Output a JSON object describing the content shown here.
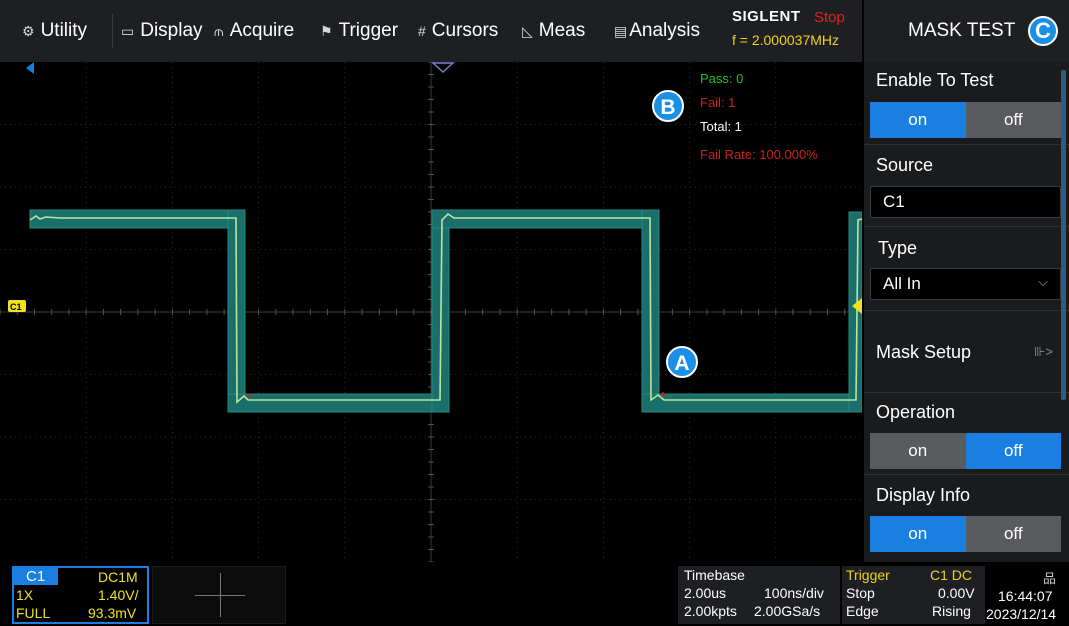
{
  "menu": {
    "items": [
      {
        "icon": "⚙",
        "label": "Utility"
      },
      {
        "icon": "▭",
        "label": "Display"
      },
      {
        "icon": "⫙",
        "label": "Acquire"
      },
      {
        "icon": "⚑",
        "label": "Trigger"
      },
      {
        "icon": "#",
        "label": "Cursors"
      },
      {
        "icon": "◺",
        "label": "Meas"
      },
      {
        "icon": "▤",
        "label": "Analysis"
      }
    ],
    "brand": "SIGLENT",
    "run_state": "Stop",
    "frequency": "f = 2.000037MHz"
  },
  "panel": {
    "title": "MASK TEST",
    "title_badge": "C",
    "enable_to_test": {
      "label": "Enable To Test",
      "on": "on",
      "off": "off",
      "selected": "on"
    },
    "source": {
      "label": "Source",
      "value": "C1"
    },
    "type": {
      "label": "Type",
      "value": "All In"
    },
    "mask_setup": {
      "label": "Mask Setup",
      "arrow": "⊪>"
    },
    "operation": {
      "label": "Operation",
      "on": "on",
      "off": "off",
      "selected": "off"
    },
    "display_info": {
      "label": "Display Info",
      "on": "on",
      "off": "off",
      "selected": "on"
    }
  },
  "stats": {
    "pass": "Pass: 0",
    "fail": "Fail: 1",
    "total": "Total: 1",
    "fail_rate": "Fail Rate: 100.000%",
    "badge": "B"
  },
  "markers": {
    "failure_badge": "A",
    "channel_marker": "C1"
  },
  "status": {
    "channel": {
      "name": "C1",
      "coupling": "DC1M",
      "probe": "1X",
      "scale": "1.40V/",
      "bandwidth": "FULL",
      "offset": "93.3mV"
    },
    "timebase": {
      "label": "Timebase",
      "delay": "2.00us",
      "scale": "100ns/div",
      "depth": "2.00kpts",
      "rate": "2.00GSa/s"
    },
    "trigger": {
      "label": "Trigger",
      "source": "C1 DC",
      "mode": "Stop",
      "level": "0.00V",
      "type": "Edge",
      "slope": "Rising"
    },
    "clock": {
      "time": "16:44:07",
      "date": "2023/12/14"
    }
  },
  "colors": {
    "accent": "#1a7fe0",
    "trace": "#b8e6a0",
    "mask": "#1b6f6a",
    "pass": "#22c022",
    "fail": "#cc2020",
    "channel": "#f2e21b"
  }
}
